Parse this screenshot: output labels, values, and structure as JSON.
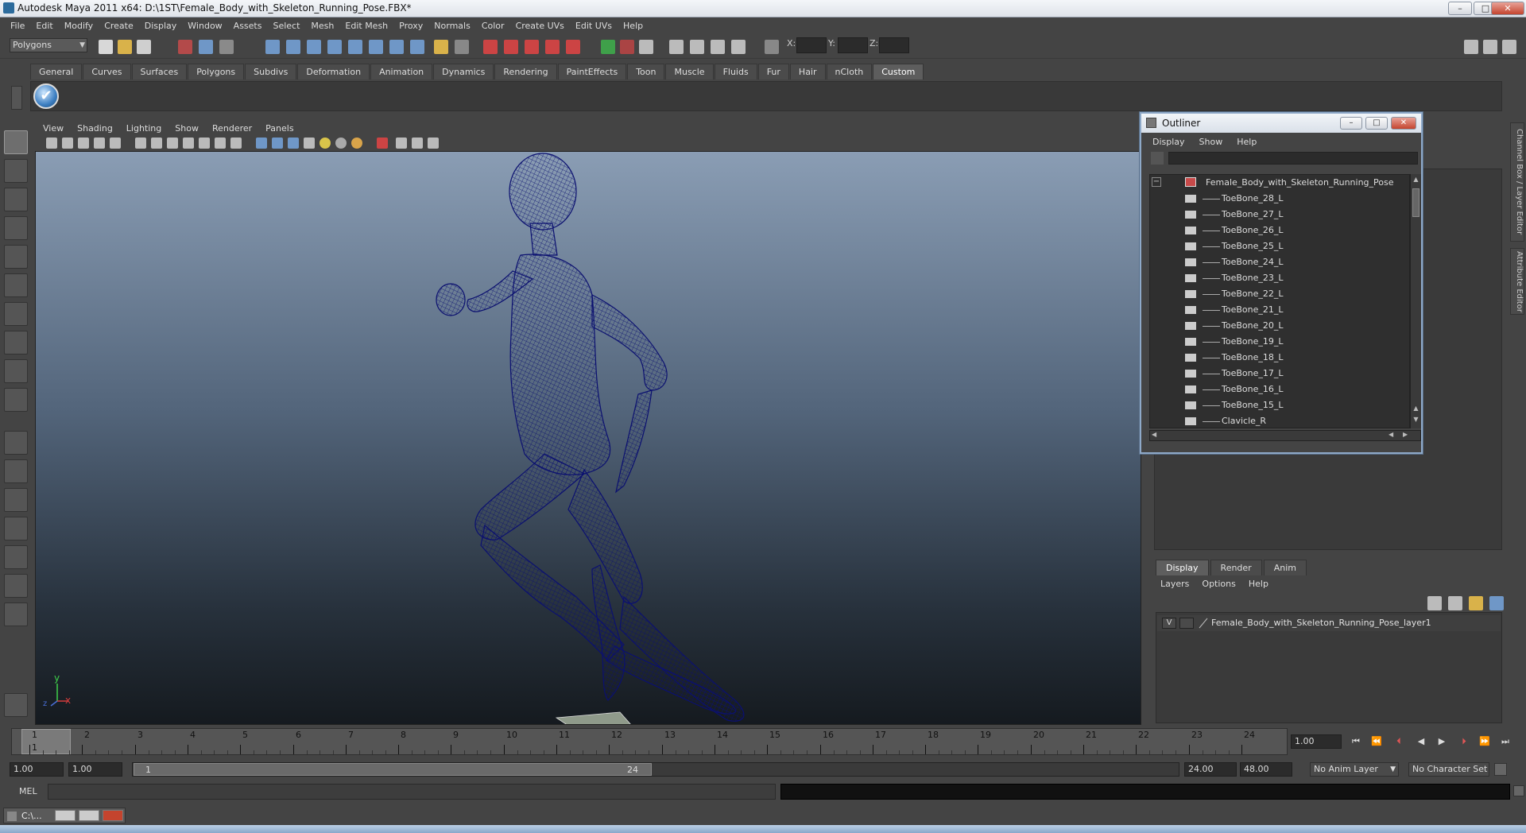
{
  "window": {
    "title": "Autodesk Maya 2011 x64: D:\\1ST\\Female_Body_with_Skeleton_Running_Pose.FBX*",
    "min": "–",
    "max": "□",
    "close": "✕"
  },
  "menubar": [
    "File",
    "Edit",
    "Modify",
    "Create",
    "Display",
    "Window",
    "Assets",
    "Select",
    "Mesh",
    "Edit Mesh",
    "Proxy",
    "Normals",
    "Color",
    "Create UVs",
    "Edit UVs",
    "Help"
  ],
  "status": {
    "mode": "Polygons",
    "x_label": "X:",
    "y_label": "Y:",
    "z_label": "Z:"
  },
  "shelf": {
    "tabs": [
      "General",
      "Curves",
      "Surfaces",
      "Polygons",
      "Subdivs",
      "Deformation",
      "Animation",
      "Dynamics",
      "Rendering",
      "PaintEffects",
      "Toon",
      "Muscle",
      "Fluids",
      "Fur",
      "Hair",
      "nCloth",
      "Custom"
    ],
    "active": "Custom",
    "icon_glyph": "✔"
  },
  "viewport": {
    "menu": [
      "View",
      "Shading",
      "Lighting",
      "Show",
      "Renderer",
      "Panels"
    ],
    "axis_y": "y",
    "axis_x": "x",
    "axis_z": "z"
  },
  "outliner": {
    "title": "Outliner",
    "menu": [
      "Display",
      "Show",
      "Help"
    ],
    "root": "Female_Body_with_Skeleton_Running_Pose",
    "items": [
      "ToeBone_28_L",
      "ToeBone_27_L",
      "ToeBone_26_L",
      "ToeBone_25_L",
      "ToeBone_24_L",
      "ToeBone_23_L",
      "ToeBone_22_L",
      "ToeBone_21_L",
      "ToeBone_20_L",
      "ToeBone_19_L",
      "ToeBone_18_L",
      "ToeBone_17_L",
      "ToeBone_16_L",
      "ToeBone_15_L",
      "Clavicle_R"
    ]
  },
  "layers": {
    "tabs": [
      "Display",
      "Render",
      "Anim"
    ],
    "active": "Display",
    "menu": [
      "Layers",
      "Options",
      "Help"
    ],
    "layer_visible": "V",
    "layer_name": "Female_Body_with_Skeleton_Running_Pose_layer1"
  },
  "sidetabs": [
    "Channel Box / Layer Editor",
    "Attribute Editor"
  ],
  "timeline": {
    "ticks": [
      "1",
      "2",
      "3",
      "4",
      "5",
      "6",
      "7",
      "8",
      "9",
      "10",
      "11",
      "12",
      "13",
      "14",
      "15",
      "16",
      "17",
      "18",
      "19",
      "20",
      "21",
      "22",
      "23",
      "24"
    ],
    "current_marker": "1",
    "current_frame": "1.00"
  },
  "range": {
    "start": "1.00",
    "playback_start": "1.00",
    "thumb_start": "1",
    "thumb_end": "24",
    "playback_end": "24.00",
    "end": "48.00",
    "anim_layer": "No Anim Layer",
    "character_set": "No Character Set"
  },
  "cmdline": {
    "label": "MEL"
  },
  "taskbar": {
    "window_label": "C:\\..."
  },
  "colors": {
    "wireframe": "#0b1070",
    "accent": "#8ea9c8"
  }
}
